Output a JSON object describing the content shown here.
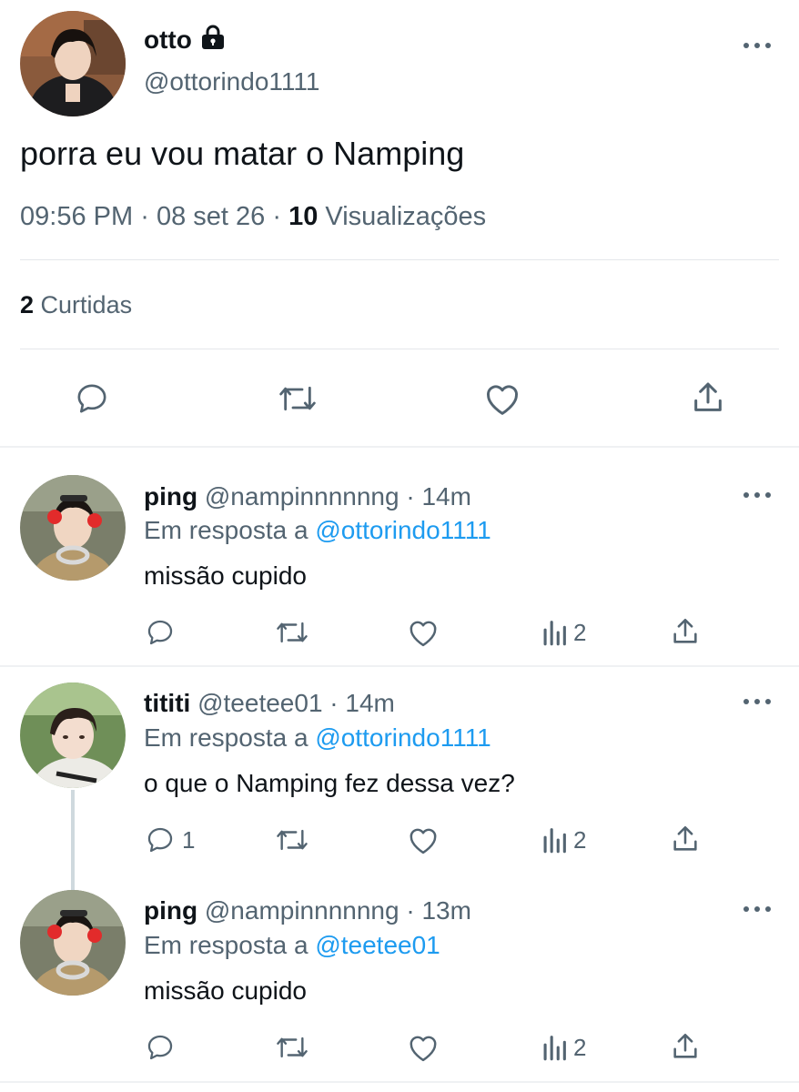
{
  "main_tweet": {
    "display_name": "otto",
    "handle": "@ottorindo1111",
    "text": "porra eu vou matar o Namping",
    "time": "09:56 PM",
    "date": "08 set 26",
    "views_count": "10",
    "views_label": "Visualizações",
    "likes_count": "2",
    "likes_label": "Curtidas"
  },
  "replies": [
    {
      "display_name": "ping",
      "handle": "@nampinnnnnng",
      "time": "14m",
      "reply_prefix": "Em resposta a",
      "reply_to": "@ottorindo1111",
      "text": "missão cupido",
      "reply_count": "",
      "views_count": "2"
    },
    {
      "display_name": "tititi",
      "handle": "@teetee01",
      "time": "14m",
      "reply_prefix": "Em resposta a",
      "reply_to": "@ottorindo1111",
      "text": "o que o Namping fez dessa vez?",
      "reply_count": "1",
      "views_count": "2"
    },
    {
      "display_name": "ping",
      "handle": "@nampinnnnnng",
      "time": "13m",
      "reply_prefix": "Em resposta a",
      "reply_to": "@teetee01",
      "text": "missão cupido",
      "reply_count": "",
      "views_count": "2"
    }
  ],
  "separator": "·",
  "colors": {
    "link": "#1d9bf0",
    "secondary": "#536471",
    "primary": "#0f1419"
  },
  "icons": [
    "lock-icon",
    "more-icon",
    "reply-icon",
    "retweet-icon",
    "like-icon",
    "share-icon",
    "views-icon"
  ]
}
